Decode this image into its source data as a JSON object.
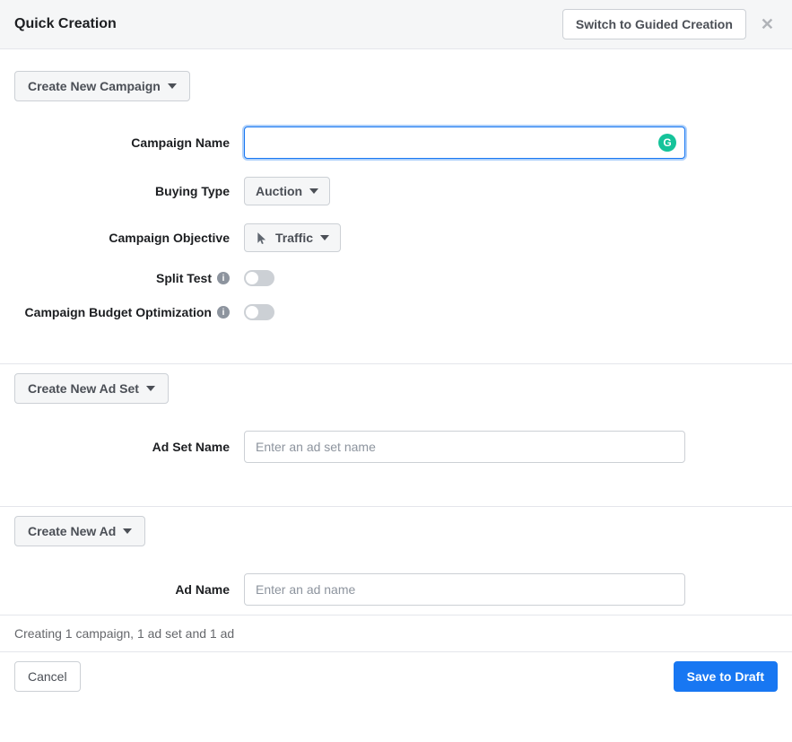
{
  "header": {
    "title": "Quick Creation",
    "switch_button": "Switch to Guided Creation"
  },
  "campaign": {
    "create_button": "Create New Campaign",
    "name_label": "Campaign Name",
    "name_value": "",
    "buying_type_label": "Buying Type",
    "buying_type_value": "Auction",
    "objective_label": "Campaign Objective",
    "objective_value": "Traffic",
    "split_test_label": "Split Test",
    "budget_opt_label": "Campaign Budget Optimization"
  },
  "adset": {
    "create_button": "Create New Ad Set",
    "name_label": "Ad Set Name",
    "name_placeholder": "Enter an ad set name",
    "name_value": ""
  },
  "ad": {
    "create_button": "Create New Ad",
    "name_label": "Ad Name",
    "name_placeholder": "Enter an ad name",
    "name_value": ""
  },
  "summary_text": "Creating 1 campaign, 1 ad set and 1 ad",
  "footer": {
    "cancel": "Cancel",
    "save": "Save to Draft"
  },
  "icons": {
    "grammarly_letter": "G",
    "info_letter": "i"
  }
}
